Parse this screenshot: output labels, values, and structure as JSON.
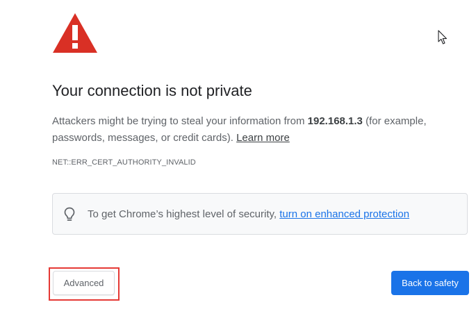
{
  "title": "Your connection is not private",
  "message": {
    "prefix": "Attackers might be trying to steal your information from ",
    "host": "192.168.1.3",
    "suffix": " (for example, passwords, messages, or credit cards). ",
    "learn_more": "Learn more"
  },
  "error_code": "NET::ERR_CERT_AUTHORITY_INVALID",
  "enhanced_protection": {
    "text": "To get Chrome’s highest level of security, ",
    "link": "turn on enhanced protection"
  },
  "buttons": {
    "advanced": "Advanced",
    "back_to_safety": "Back to safety"
  },
  "icons": {
    "warning": "warning-triangle-icon",
    "bulb": "lightbulb-icon",
    "cursor": "mouse-cursor-icon"
  },
  "colors": {
    "warning_red": "#d93025",
    "primary_blue": "#1a73e8",
    "highlight_red": "#e53935"
  }
}
